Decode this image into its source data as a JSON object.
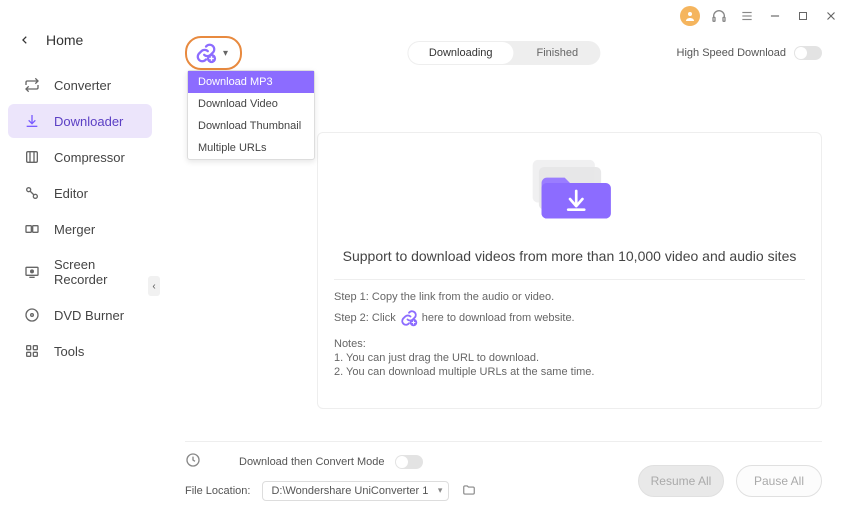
{
  "titlebar": {},
  "sidebar": {
    "back_label": "Home",
    "items": [
      {
        "label": "Converter"
      },
      {
        "label": "Downloader"
      },
      {
        "label": "Compressor"
      },
      {
        "label": "Editor"
      },
      {
        "label": "Merger"
      },
      {
        "label": "Screen Recorder"
      },
      {
        "label": "DVD Burner"
      },
      {
        "label": "Tools"
      }
    ]
  },
  "tabs": {
    "downloading": "Downloading",
    "finished": "Finished"
  },
  "hsd_label": "High Speed Download",
  "dropdown": {
    "items": [
      "Download MP3",
      "Download Video",
      "Download Thumbnail",
      "Multiple URLs"
    ]
  },
  "content": {
    "support": "Support to download videos from more than 10,000 video and audio sites",
    "step1": "Step 1: Copy the link from the audio or video.",
    "step2a": "Step 2: Click",
    "step2b": "here to download from website.",
    "notes_label": "Notes:",
    "note1": "1. You can just drag the URL to download.",
    "note2": "2. You can download multiple URLs at the same time."
  },
  "footer": {
    "convert_mode": "Download then Convert Mode",
    "file_location_label": "File Location:",
    "file_location_value": "D:\\Wondershare UniConverter 1",
    "resume": "Resume All",
    "pause": "Pause All"
  }
}
